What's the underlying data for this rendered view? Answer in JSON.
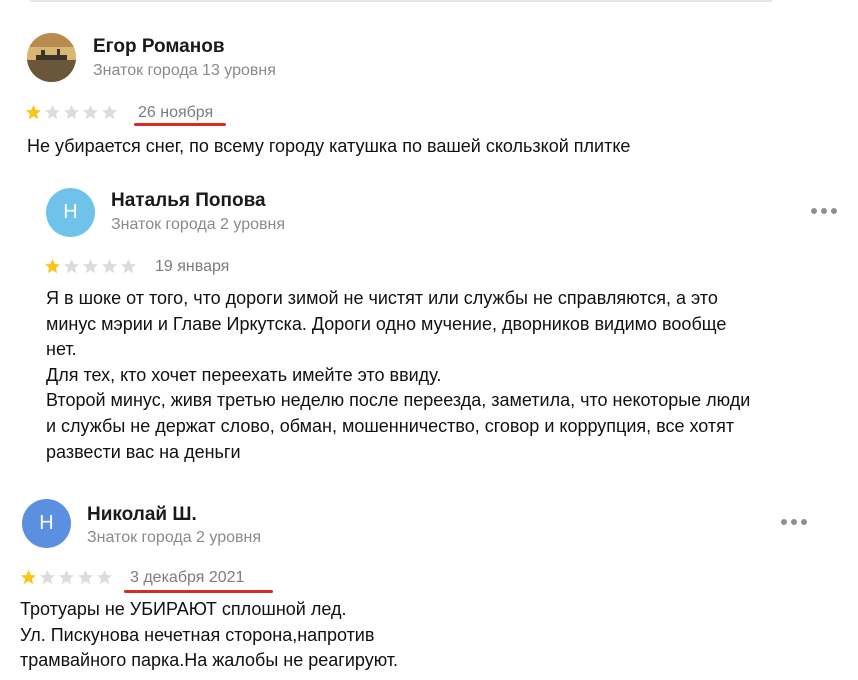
{
  "reviews": [
    {
      "author": "Егор Романов",
      "level": "Знаток города 13 уровня",
      "rating": 1,
      "date": "26 ноября",
      "lines": [
        "Не убирается снег, по всему городу катушка по вашей скользкой плитке"
      ]
    },
    {
      "avatar_letter": "Н",
      "avatar_color": "#6fc3ea",
      "author": "Наталья Попова",
      "level": "Знаток города 2 уровня",
      "rating": 1,
      "date": "19 января",
      "lines": [
        "Я в шоке от того, что дороги зимой не чистят или службы не справляются, а это",
        "минус мэрии и Главе Иркутска. Дороги одно мучение, дворников видимо вообще",
        "нет.",
        "Для тех, кто хочет переехать имейте это ввиду.",
        "Второй минус, живя третью неделю после переезда, заметила, что некоторые люди",
        "и службы не держат слово, обман, мошенничество, сговор и коррупция, все хотят",
        "развести вас на деньги"
      ]
    },
    {
      "avatar_letter": "Н",
      "avatar_color": "#5b8fe0",
      "author": "Николай Ш.",
      "level": "Знаток города 2 уровня",
      "rating": 1,
      "date": "3 декабря 2021",
      "lines": [
        "Тротуары не УБИРАЮТ сплошной лед.",
        "Ул. Пискунова нечетная сторона,напротив",
        "трамвайного парка.На жалобы не реагируют."
      ]
    }
  ],
  "colors": {
    "star_filled": "#fcc419",
    "star_empty": "#dcdcdc",
    "underline": "#d42b25"
  },
  "icons": {
    "star": "star-icon",
    "more": "more-dots-icon"
  }
}
